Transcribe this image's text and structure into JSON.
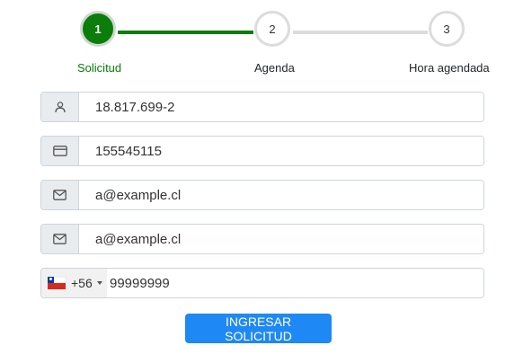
{
  "stepper": {
    "steps": [
      {
        "number": "1",
        "label": "Solicitud",
        "state": "active"
      },
      {
        "number": "2",
        "label": "Agenda",
        "state": "pending"
      },
      {
        "number": "3",
        "label": "Hora agendada",
        "state": "pending"
      }
    ],
    "active_color": "#0a7d0a",
    "inactive_color": "#dcdcdc"
  },
  "form": {
    "rut": {
      "value": "18.817.699-2",
      "icon": "user-icon"
    },
    "document": {
      "value": "155545115",
      "icon": "credit-card-icon"
    },
    "email": {
      "value": "a@example.cl",
      "icon": "envelope-icon"
    },
    "email_confirm": {
      "value": "a@example.cl",
      "icon": "envelope-icon"
    },
    "phone": {
      "country_flag": "chile-flag-icon",
      "dial_code": "+56",
      "value": "99999999"
    }
  },
  "submit": {
    "label": "INGRESAR SOLICITUD",
    "color": "#1e88f5"
  }
}
